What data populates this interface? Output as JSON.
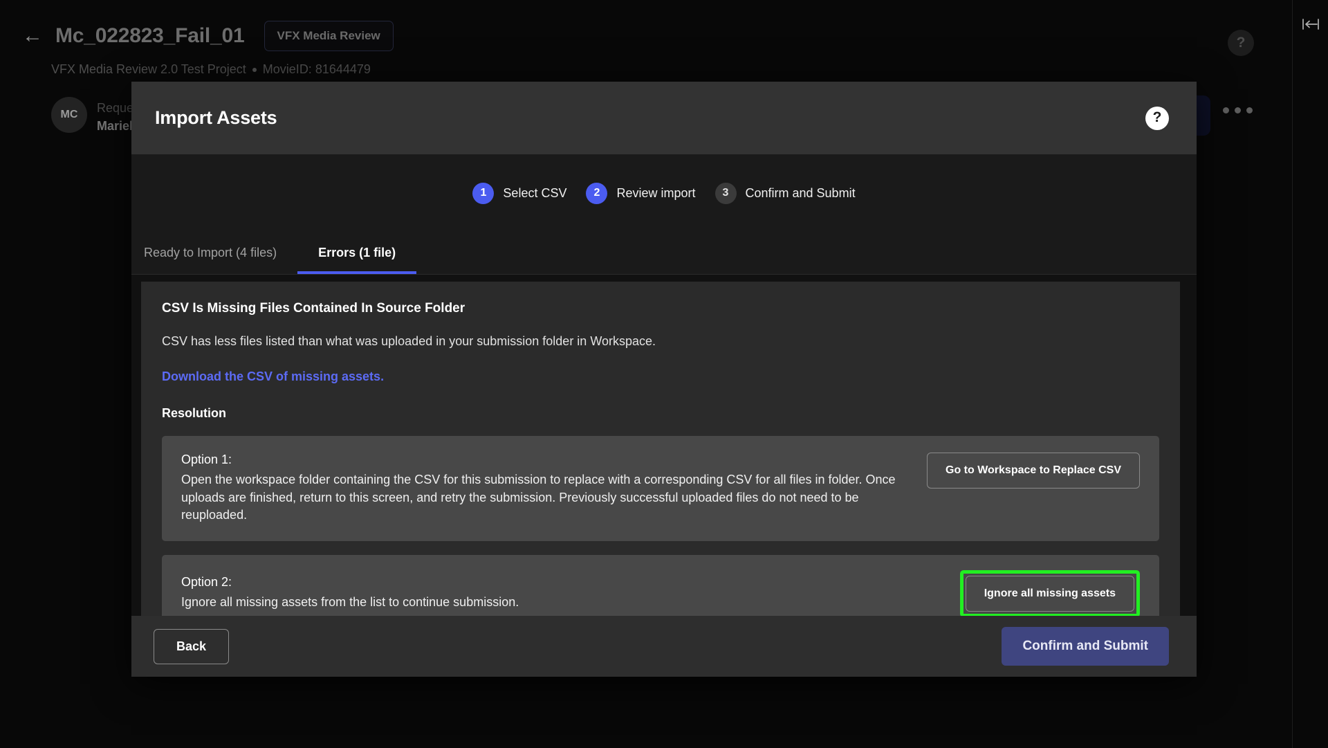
{
  "background": {
    "back_arrow_icon": "arrow-left-icon",
    "title": "Mc_022823_Fail_01",
    "tag": "VFX Media Review",
    "subtitle_project": "VFX Media Review 2.0 Test Project",
    "subtitle_movie_id": "MovieID: 81644479",
    "avatar_initials": "MC",
    "requester_label": "Requester",
    "requester_name": "Marielle",
    "help_icon": "question-mark-icon",
    "more_icon": "ellipsis-icon",
    "collapse_icon": "collapse-panel-icon"
  },
  "modal": {
    "title": "Import Assets",
    "help_icon": "question-mark-circle-icon",
    "stepper": [
      {
        "number": "1",
        "label": "Select CSV",
        "state": "active"
      },
      {
        "number": "2",
        "label": "Review import",
        "state": "active"
      },
      {
        "number": "3",
        "label": "Confirm and Submit",
        "state": "inactive"
      }
    ],
    "tabs": [
      {
        "label": "Ready to Import (4 files)",
        "active": false
      },
      {
        "label": "Errors (1 file)",
        "active": true
      }
    ],
    "error": {
      "title": "CSV Is Missing Files Contained In Source Folder",
      "description": "CSV has less files listed than what was uploaded in your submission folder in Workspace.",
      "download_link": "Download the CSV of missing assets.",
      "resolution_heading": "Resolution",
      "options": [
        {
          "label": "Option 1:",
          "body": "Open the workspace folder containing the CSV for this submission to replace with a corresponding CSV for all files in folder. Once uploads are finished, return to this screen, and retry the submission. Previously successful uploaded files do not need to be reuploaded.",
          "button": "Go to Workspace to Replace CSV",
          "highlighted": false
        },
        {
          "label": "Option 2:",
          "body": "Ignore all missing assets from the list to continue submission.",
          "button": "Ignore all missing assets",
          "highlighted": true
        }
      ]
    },
    "footer": {
      "back": "Back",
      "submit": "Confirm and Submit"
    }
  },
  "colors": {
    "accent_blue": "#4b5cf0",
    "link_blue": "#5c6bf5",
    "primary_button": "#3f4580",
    "highlight_green": "#22ef22",
    "modal_body": "#1a1a1a",
    "modal_header": "#333333",
    "content_panel": "#2b2b2b",
    "option_card": "#484848"
  }
}
